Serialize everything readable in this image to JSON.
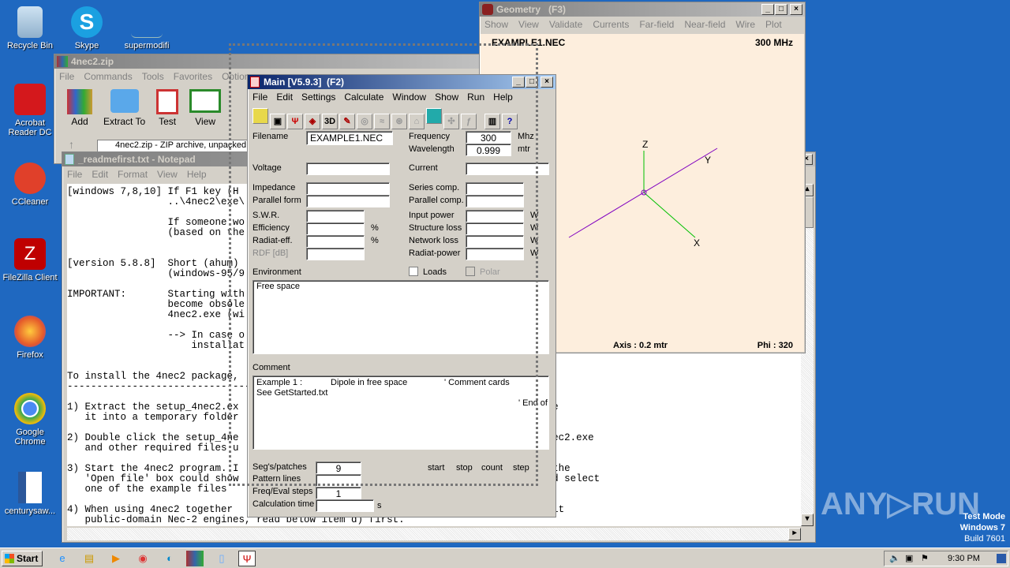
{
  "desktop": {
    "icons": [
      {
        "label": "Recycle Bin"
      },
      {
        "label": "Skype"
      },
      {
        "label": "supermodifi"
      },
      {
        "label": "Acrobat Reader DC"
      },
      {
        "label": "CCleaner"
      },
      {
        "label": "FileZilla Client"
      },
      {
        "label": "Firefox"
      },
      {
        "label": "Google Chrome"
      },
      {
        "label": "centurysaw..."
      }
    ],
    "watermark": "ANY▷RUN",
    "test_mode": [
      "Test Mode",
      "Windows 7",
      "Build 7601"
    ]
  },
  "winrar": {
    "title": "4nec2.zip",
    "menu": [
      "File",
      "Commands",
      "Tools",
      "Favorites",
      "Options"
    ],
    "tools": [
      "Add",
      "Extract To",
      "Test",
      "View"
    ],
    "path": "4nec2.zip - ZIP archive, unpacked"
  },
  "notepad": {
    "title": "_readmefirst.txt - Notepad",
    "menu": [
      "File",
      "Edit",
      "Format",
      "View",
      "Help"
    ],
    "lines": [
      "[windows 7,8,10] If F1 key (H",
      "                 ..\\4nec2\\exe\\",
      "",
      "                 If someone wo",
      "                 (based on the",
      "",
      "",
      "[version 5.8.8]  Short (ahum)",
      "                 (windows-95/9",
      "",
      "IMPORTANT:       Starting with",
      "                 become obsole",
      "                 4nec2.exe (wi",
      "",
      "                 --> In case o",
      "                     installat",
      "",
      "",
      "To install the 4nec2 package,",
      "-------------------------------",
      "",
      "1) Extract the setup_4nec2.ex                                                     e",
      "   it into a temporary folder",
      "",
      "2) Double click the setup_4ne                                                     ec2.exe",
      "   and other required files u",
      "",
      "3) Start the 4nec2 program. I                                                     the",
      "   'Open file' box could show                                                     d select",
      "   one of the example files",
      "",
      "4) When using 4nec2 together                                                      lt",
      "   public-domain Nec-2 engines, read below item d) first."
    ]
  },
  "geometry": {
    "title": "Geometry   (F3)",
    "menu": [
      "Show",
      "View",
      "Validate",
      "Currents",
      "Far-field",
      "Near-field",
      "Wire",
      "Plot"
    ],
    "file": "EXAMPLE1.NEC",
    "freq": "300 MHz",
    "axes": {
      "z": "Z",
      "y": "Y",
      "x": "X"
    },
    "axis_info": "Axis : 0.2 mtr",
    "phi": "Phi : 320",
    "colors": {
      "axis": "#00c000",
      "wire": "#8000c0",
      "bg": "#fdeedd"
    }
  },
  "main": {
    "title": "Main [V5.9.3]  (F2)",
    "menu": [
      "File",
      "Edit",
      "Settings",
      "Calculate",
      "Window",
      "Show",
      "Run",
      "Help"
    ],
    "filename_label": "Filename",
    "filename": "EXAMPLE1.NEC",
    "frequency_label": "Frequency",
    "frequency": "300",
    "frequency_unit": "Mhz",
    "wavelength_label": "Wavelength",
    "wavelength": "0.999",
    "wavelength_unit": "mtr",
    "voltage_label": "Voltage",
    "current_label": "Current",
    "impedance_label": "Impedance",
    "parallel_form_label": "Parallel form",
    "series_comp_label": "Series comp.",
    "parallel_comp_label": "Parallel comp.",
    "swr_label": "S.W.R.",
    "efficiency_label": "Efficiency",
    "radiat_eff_label": "Radiat-eff.",
    "rdf_label": "RDF [dB]",
    "pct": "%",
    "input_power_label": "Input power",
    "structure_loss_label": "Structure loss",
    "network_loss_label": "Network loss",
    "radiat_power_label": "Radiat-power",
    "w": "W",
    "environment_label": "Environment",
    "loads_label": "Loads",
    "polar_label": "Polar",
    "environment": "Free space",
    "comment_label": "Comment",
    "comment_col1": "Example 1 :",
    "comment_col2": "Dipole in free space",
    "comment_col3": "' Comment cards",
    "comment_line2": "See GetStarted.txt",
    "comment_end": "' End of",
    "segs_label": "Seg's/patches",
    "segs": "9",
    "pattern_label": "Pattern lines",
    "freq_steps_label": "Freq/Eval steps",
    "freq_steps": "1",
    "calc_time_label": "Calculation time",
    "calc_unit": "s",
    "col_start": "start",
    "col_stop": "stop",
    "col_count": "count",
    "col_step": "step"
  },
  "taskbar": {
    "start": "Start",
    "clock": "9:30 PM"
  }
}
